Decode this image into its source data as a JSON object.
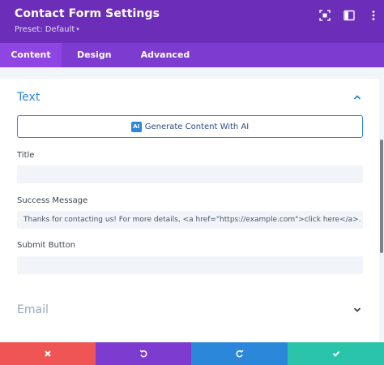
{
  "header": {
    "title": "Contact Form Settings",
    "preset_label": "Preset: Default",
    "caret": "▾",
    "icons": [
      "focus-icon",
      "split-view-icon",
      "more-icon"
    ]
  },
  "tabs": [
    {
      "label": "Content",
      "active": true
    },
    {
      "label": "Design",
      "active": false
    },
    {
      "label": "Advanced",
      "active": false
    }
  ],
  "text_section": {
    "title": "Text",
    "expanded": true,
    "ai_button": {
      "badge": "AI",
      "label": "Generate Content With AI"
    },
    "fields": {
      "title": {
        "label": "Title",
        "value": ""
      },
      "success_message": {
        "label": "Success Message",
        "value": "Thanks for contacting us! For more details, <a href=\"https://example.com\">click here</a>."
      },
      "submit_button": {
        "label": "Submit Button",
        "value": ""
      }
    }
  },
  "email_section": {
    "title": "Email",
    "expanded": false
  },
  "footer": {
    "buttons": [
      "discard",
      "undo",
      "redo",
      "save"
    ]
  },
  "colors": {
    "header": "#6c2eb9",
    "tabs": "#7e3bd0",
    "active_tab": "#8f45e1",
    "accent": "#2b87da",
    "discard": "#ef5555",
    "undo": "#7e3bd0",
    "redo": "#2b87da",
    "save": "#29c4a9"
  }
}
